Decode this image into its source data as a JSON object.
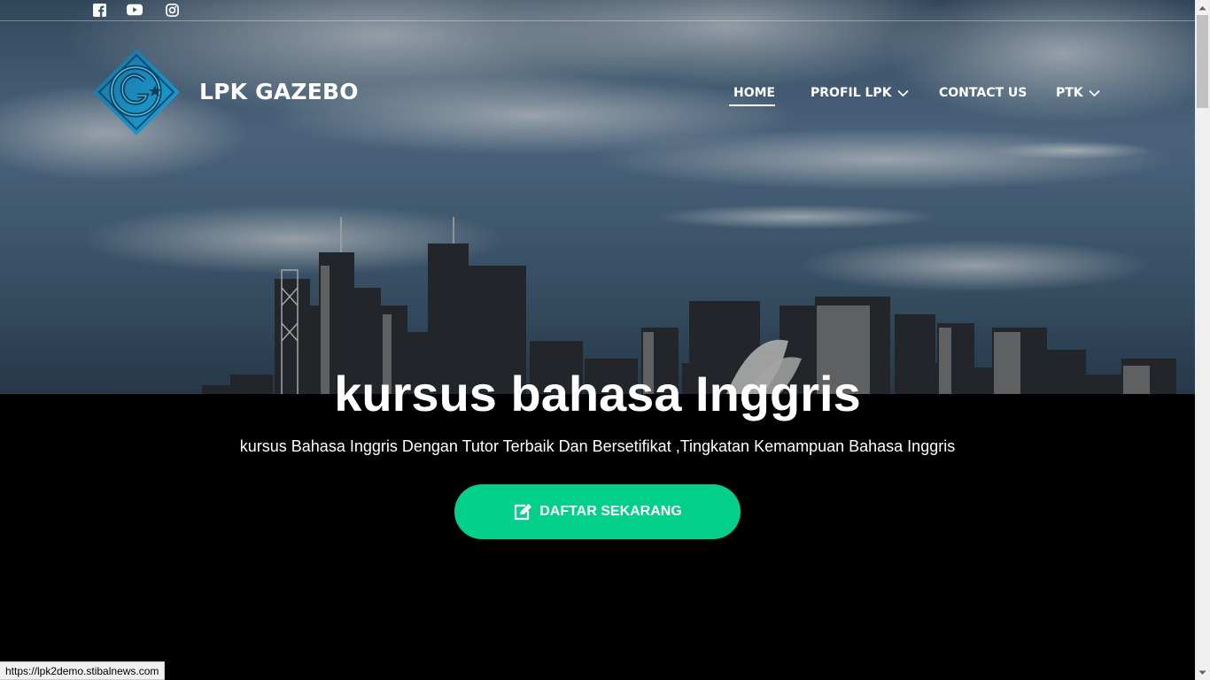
{
  "site": {
    "brand": "LPK GAZEBO",
    "status_url": "https://lpk2demo.stibalnews.com"
  },
  "social": [
    {
      "icon": "facebook-icon"
    },
    {
      "icon": "youtube-icon"
    },
    {
      "icon": "instagram-icon"
    }
  ],
  "nav": {
    "items": [
      {
        "label": "HOME",
        "active": true
      },
      {
        "label": "PROFIL LPK",
        "dropdown": true
      },
      {
        "label": "CONTACT US"
      },
      {
        "label": "PTK",
        "dropdown": true
      }
    ]
  },
  "hero": {
    "title": "kursus bahasa Inggris",
    "subtitle": "kursus Bahasa Inggris Dengan Tutor Terbaik Dan Bersetifikat ,Tingkatan Kemampuan Bahasa Inggris",
    "cta_label": "DAFTAR SEKARANG"
  },
  "colors": {
    "accent": "#02cf8a",
    "logo_blue": "#1a9fd6",
    "background": "#000000"
  }
}
